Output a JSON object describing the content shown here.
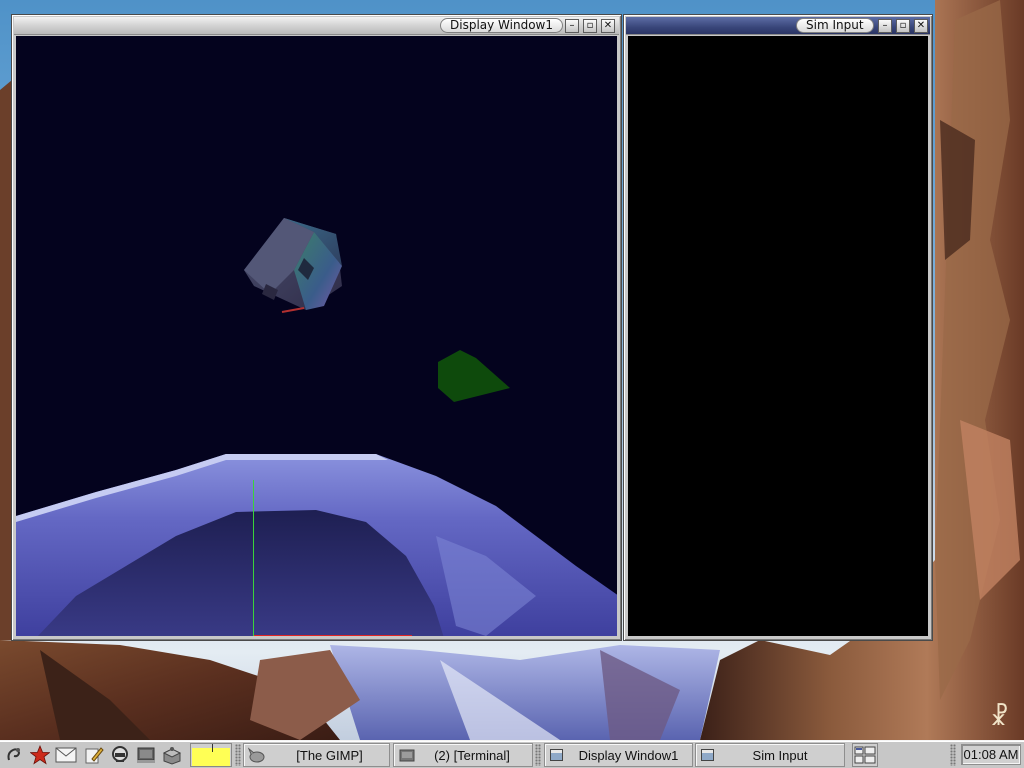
{
  "desktop": {
    "wallpaper": "mountain-painting-wallpaper",
    "signature_glyph": "☧"
  },
  "windows": {
    "display": {
      "title": "Display Window1",
      "buttons": [
        "minimize",
        "maximize",
        "close"
      ],
      "scene": {
        "background_color": "#04031e",
        "objects": [
          "rotating-cube",
          "green-pentagon",
          "terrain-surface",
          "green-axis-line",
          "red-axis-line"
        ]
      }
    },
    "sim": {
      "title": "Sim Input",
      "buttons": [
        "minimize",
        "maximize",
        "close"
      ],
      "background_color": "#000000"
    }
  },
  "taskbar": {
    "launchers": [
      "gnome-foot-icon",
      "star-icon",
      "mail-icon",
      "pencil-icon",
      "help-icon",
      "terminal-icon",
      "package-icon"
    ],
    "pager_active_color": "#ffff55",
    "tasks": [
      {
        "label": "[The GIMP]",
        "icon": "gimp-icon"
      },
      {
        "label": "(2) [Terminal]",
        "icon": "terminal-icon"
      },
      {
        "label": "Display Window1",
        "icon": "window-icon"
      },
      {
        "label": "Sim Input",
        "icon": "window-icon"
      }
    ],
    "clock": "01:08 AM"
  }
}
